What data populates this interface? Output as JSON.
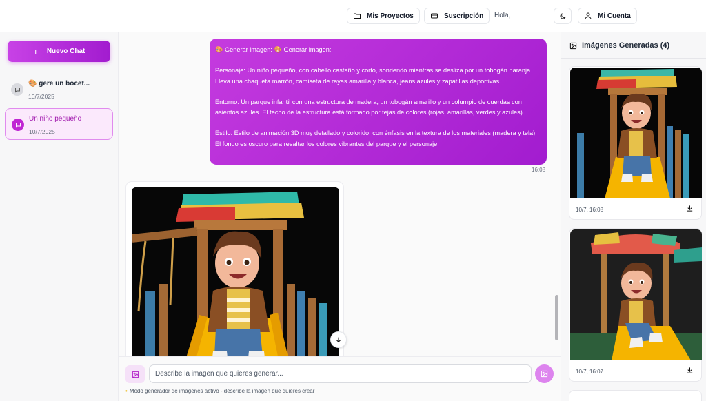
{
  "header": {
    "projects_label": "Mis Proyectos",
    "subscription_label": "Suscripción",
    "greeting": "Hola,",
    "account_label": "Mi Cuenta"
  },
  "sidebar": {
    "new_chat_label": "Nuevo Chat",
    "items": [
      {
        "title": "🎨 gere un bocet...",
        "date": "10/7/2025",
        "active": false
      },
      {
        "title": "Un niño pequeño",
        "date": "10/7/2025",
        "active": true
      }
    ]
  },
  "chat": {
    "user_message": {
      "line1": "🎨 Generar imagen: 🎨 Generar imagen:",
      "para1": "Personaje: Un niño pequeño, con cabello castaño y corto, sonriendo mientras se desliza por un tobogán naranja. Lleva una chaqueta marrón, camiseta de rayas amarilla y blanca, jeans azules y zapatillas deportivas.",
      "para2": "Entorno: Un parque infantil con una estructura de madera, un tobogán amarillo y un columpio de cuerdas con asientos azules. El techo de la estructura está formado por tejas de colores (rojas, amarillas, verdes y azules).",
      "para3": "Estilo: Estilo de animación 3D muy detallado y colorido, con énfasis en la textura de los materiales (madera y tela). El fondo es oscuro para resaltar los colores vibrantes del parque y el personaje.",
      "time": "16:08"
    }
  },
  "input": {
    "placeholder": "Describe la imagen que quieres generar...",
    "value": "",
    "mode_note": "Modo generador de imágenes activo - describe la imagen que quieres crear"
  },
  "gallery": {
    "title": "Imágenes Generadas (4)",
    "items": [
      {
        "timestamp": "10/7, 16:08"
      },
      {
        "timestamp": "10/7, 16:07"
      }
    ]
  },
  "colors": {
    "accent": "#c026d3",
    "accent_light": "#fbe9fc",
    "slide_yellow": "#f5b400"
  },
  "icons": {
    "projects": "folder-icon",
    "subscription": "credit-card-icon",
    "theme": "moon-icon",
    "account": "user-icon",
    "chat": "message-icon",
    "gallery": "image-icon",
    "download": "download-icon",
    "scroll": "arrow-down-icon",
    "send": "image-send-icon",
    "note": "lightbulb-icon"
  }
}
